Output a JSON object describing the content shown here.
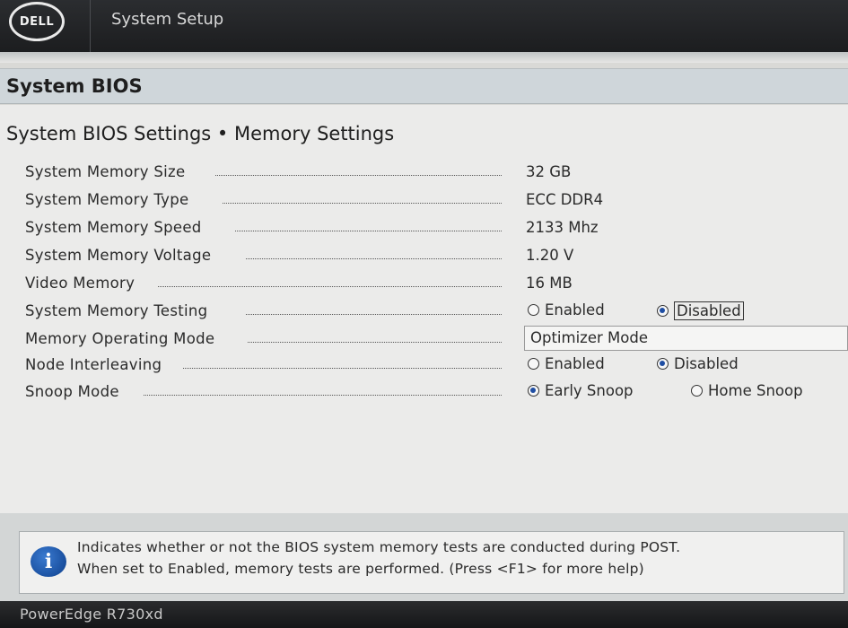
{
  "header": {
    "logo_text": "DELL",
    "app_title": "System Setup"
  },
  "section": {
    "title": "System BIOS"
  },
  "page": {
    "title": "System BIOS Settings • Memory Settings"
  },
  "settings": [
    {
      "label": "System Memory Size",
      "value": "32 GB"
    },
    {
      "label": "System Memory Type",
      "value": "ECC DDR4"
    },
    {
      "label": "System Memory Speed",
      "value": "2133 Mhz"
    },
    {
      "label": "System Memory Voltage",
      "value": "1.20 V"
    },
    {
      "label": "Video Memory",
      "value": "16 MB"
    },
    {
      "label": "System Memory Testing",
      "options": [
        "Enabled",
        "Disabled"
      ],
      "selected": "Disabled"
    },
    {
      "label": "Memory Operating Mode",
      "selected_value": "Optimizer Mode"
    },
    {
      "label": "Node Interleaving",
      "options": [
        "Enabled",
        "Disabled"
      ],
      "selected": "Disabled"
    },
    {
      "label": "Snoop Mode",
      "options": [
        "Early Snoop",
        "Home Snoop"
      ],
      "selected": "Early Snoop"
    }
  ],
  "help": {
    "icon": "info-icon",
    "line1": "Indicates whether or not the BIOS system memory tests are conducted during POST.",
    "line2": "When set to Enabled, memory tests are performed. (Press <F1> for more help)"
  },
  "footer": {
    "model": "PowerEdge R730xd"
  }
}
